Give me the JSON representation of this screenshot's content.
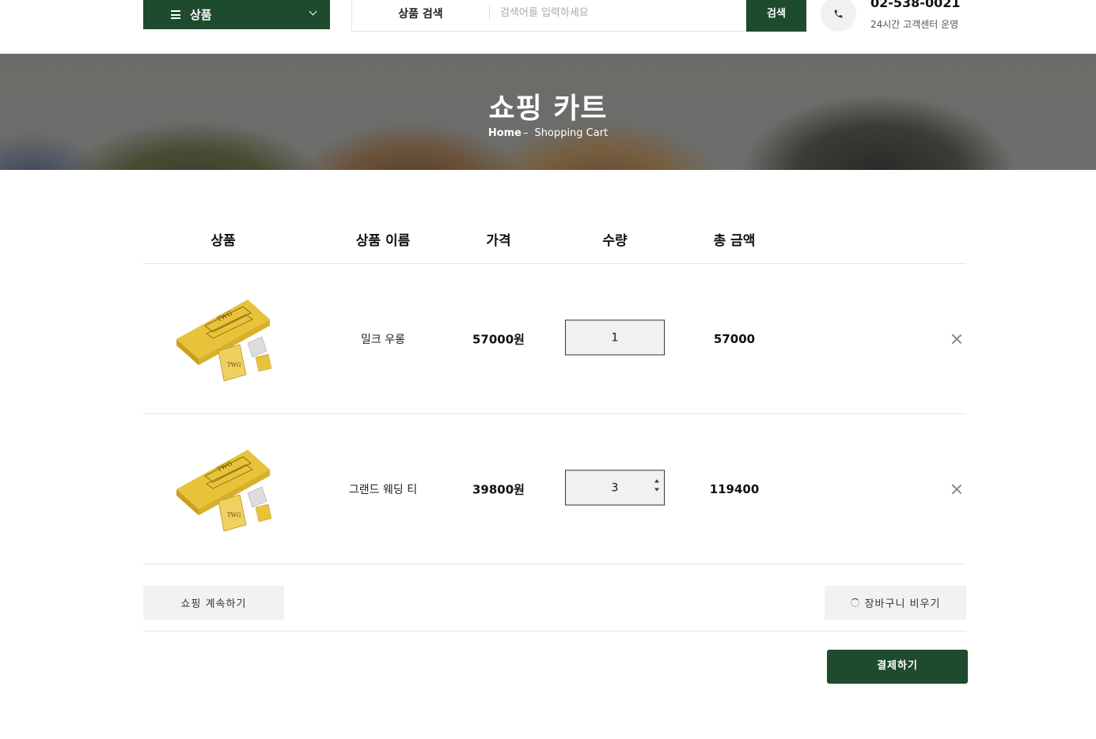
{
  "header": {
    "category_label": "상품",
    "search_label": "상품 검색",
    "search_placeholder": "검색어를 입력하세요",
    "search_button": "검색",
    "phone_number": "02-538-0021",
    "phone_sub": "24시간 고객센터 운영"
  },
  "banner": {
    "title": "쇼핑 카트",
    "breadcrumb_home": "Home",
    "breadcrumb_sep": "–",
    "breadcrumb_current": "Shopping Cart"
  },
  "cart": {
    "columns": [
      "상품",
      "상품 이름",
      "가격",
      "수량",
      "총 금액"
    ],
    "items": [
      {
        "image_icon": "twg-tea-box",
        "name": "밀크 우롱",
        "price": "57000원",
        "quantity": "1",
        "total": "57000"
      },
      {
        "image_icon": "twg-tea-box",
        "name": "그랜드 웨딩 티",
        "price": "39800원",
        "quantity": "3",
        "total": "119400"
      }
    ]
  },
  "actions": {
    "continue_shopping": "쇼핑 계속하기",
    "clear_cart": "장바구니 비우기",
    "checkout": "결제하기"
  },
  "colors": {
    "brand_green": "#1e4a2e",
    "button_gray": "#f2f2f2"
  }
}
